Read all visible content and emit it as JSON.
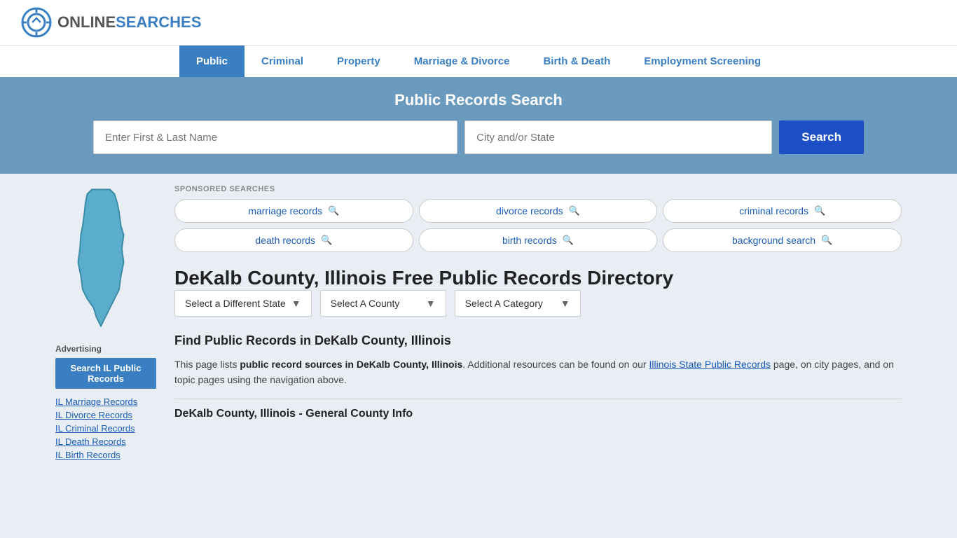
{
  "header": {
    "logo_online": "ONLINE",
    "logo_searches": "SEARCHES"
  },
  "nav": {
    "items": [
      {
        "label": "Public",
        "active": true
      },
      {
        "label": "Criminal",
        "active": false
      },
      {
        "label": "Property",
        "active": false
      },
      {
        "label": "Marriage & Divorce",
        "active": false
      },
      {
        "label": "Birth & Death",
        "active": false
      },
      {
        "label": "Employment Screening",
        "active": false
      }
    ]
  },
  "search_banner": {
    "title": "Public Records Search",
    "name_placeholder": "Enter First & Last Name",
    "location_placeholder": "City and/or State",
    "button_label": "Search"
  },
  "sponsored": {
    "label": "SPONSORED SEARCHES",
    "items": [
      "marriage records",
      "divorce records",
      "criminal records",
      "death records",
      "birth records",
      "background search"
    ]
  },
  "page": {
    "title": "DeKalb County, Illinois Free Public Records Directory",
    "dropdowns": [
      {
        "label": "Select a Different State"
      },
      {
        "label": "Select A County"
      },
      {
        "label": "Select A Category"
      }
    ],
    "find_title": "Find Public Records in DeKalb County, Illinois",
    "find_desc_1": "This page lists ",
    "find_desc_bold": "public record sources in DeKalb County, Illinois",
    "find_desc_2": ". Additional resources can be found on our ",
    "find_link_text": "Illinois State Public Records",
    "find_desc_3": " page, on city pages, and on topic pages using the navigation above.",
    "county_info_title": "DeKalb County, Illinois - General County Info"
  },
  "sidebar": {
    "advertising_label": "Advertising",
    "ad_button": "Search IL Public Records",
    "links": [
      "IL Marriage Records",
      "IL Divorce Records",
      "IL Criminal Records",
      "IL Death Records",
      "IL Birth Records"
    ]
  }
}
